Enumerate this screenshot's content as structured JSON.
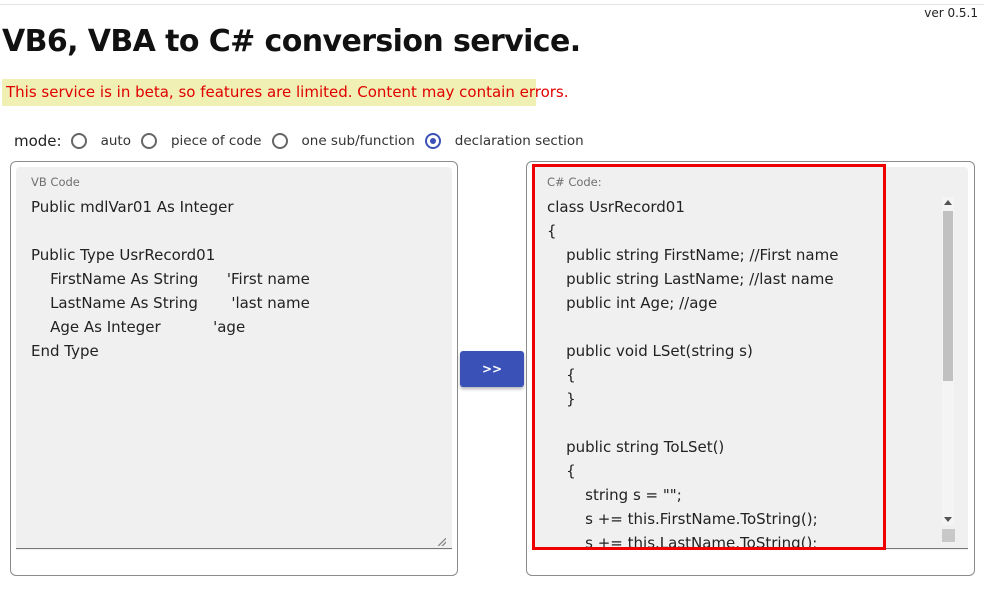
{
  "header": {
    "version": "ver 0.5.1",
    "title": "VB6, VBA to C# conversion service.",
    "beta_notice": "This service is in beta, so features are limited. Content may contain errors."
  },
  "mode": {
    "label": "mode:",
    "options": [
      {
        "label": "auto",
        "checked": false
      },
      {
        "label": "piece of code",
        "checked": false
      },
      {
        "label": "one sub/function",
        "checked": false
      },
      {
        "label": "declaration section",
        "checked": true
      }
    ]
  },
  "vb_panel": {
    "label": "VB Code",
    "code": "Public mdlVar01 As Integer\n\nPublic Type UsrRecord01\n    FirstName As String      'First name\n    LastName As String       'last name\n    Age As Integer           'age\nEnd Type"
  },
  "convert_button": {
    "label": ">>"
  },
  "cs_panel": {
    "label": "C# Code:",
    "code": "class UsrRecord01\n{\n    public string FirstName; //First name\n    public string LastName; //last name\n    public int Age; //age\n\n    public void LSet(string s)\n    {\n    }\n\n    public string ToLSet()\n    {\n        string s = \"\";\n        s += this.FirstName.ToString();\n        s += this.LastName.ToString();"
  },
  "colors": {
    "accent": "#3a52b7",
    "beta_background": "#f0f0b4",
    "beta_text": "#e00000",
    "highlight": "#ee0000"
  }
}
